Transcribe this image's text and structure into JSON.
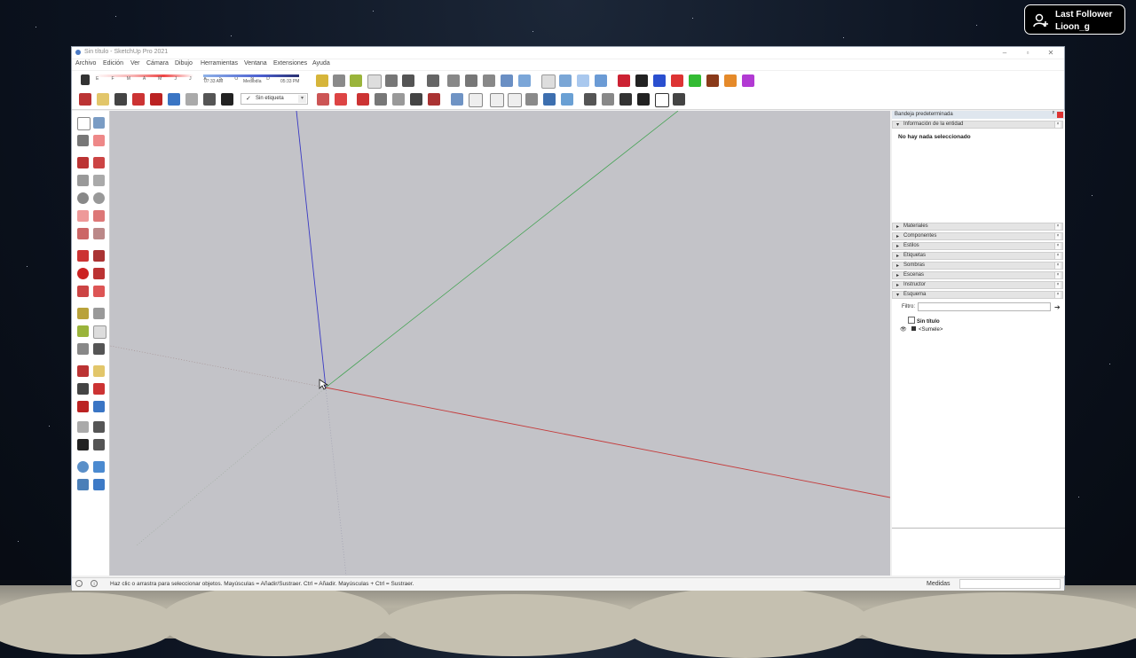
{
  "overlay": {
    "title": "Last Follower",
    "name": "Lioon_g"
  },
  "window": {
    "title": "Sin título - SketchUp Pro 2021",
    "minimize": "–",
    "maximize": "▫",
    "close": "✕"
  },
  "menu": [
    "Archivo",
    "Edición",
    "Ver",
    "Cámara",
    "Dibujo",
    "Herramientas",
    "Ventana",
    "Extensiones",
    "Ayuda"
  ],
  "shadows": {
    "months": "E F M A M J J A S O N D",
    "time_start": "07:33 AM",
    "time_mid": "Mediodía",
    "time_end": "05:33 PM"
  },
  "tag_dropdown": {
    "check": "✓",
    "value": "Sin etiqueta",
    "arrow": "▾"
  },
  "tray": {
    "title": "Bandeja predeterminada",
    "pin": "ᵖ",
    "entity_panel": "Información de la entidad",
    "entity_status": "No hay nada seleccionado",
    "panels": [
      "Materiales",
      "Componentes",
      "Estilos",
      "Etiquetas",
      "Sombras",
      "Escenas",
      "Instructor",
      "Esquema"
    ],
    "collapsed_marker": "▸",
    "expanded_marker": "▾",
    "close_marker": "×",
    "filter_label": "Filtro:",
    "filter_value": "",
    "filter_button": "➔",
    "outline_root": "Sin título",
    "outline_child": "<Sumele>"
  },
  "status": {
    "hint": "Haz clic o arrastra para seleccionar objetos. Mayúsculas = Añadir/Sustraer. Ctrl = Añadir. Mayúsculas + Ctrl = Sustraer.",
    "measures_label": "Medidas",
    "measures_value": ""
  },
  "colors": {
    "x_axis": "#c43a3a",
    "y_axis": "#3aa04a",
    "z_axis": "#3a3ac4",
    "viewport": "#c3c3c8"
  }
}
